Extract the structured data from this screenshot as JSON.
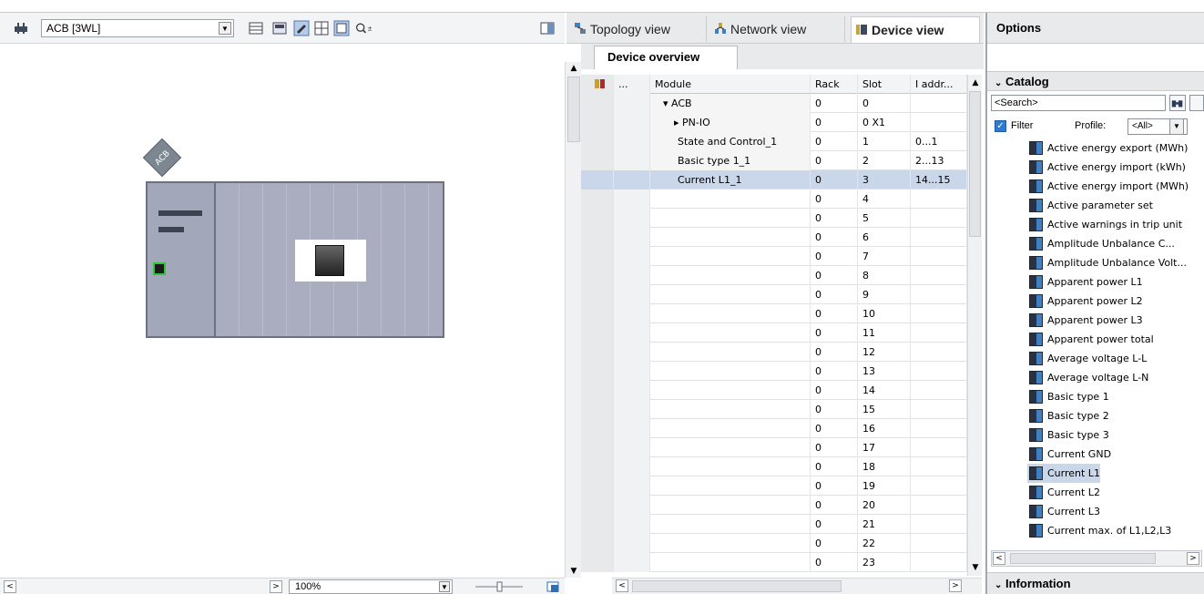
{
  "left": {
    "device_select": "ACB [3WL]",
    "zoom": "100%",
    "rack_label": "ACB"
  },
  "view_tabs": [
    {
      "label": "Topology view"
    },
    {
      "label": "Network view"
    },
    {
      "label": "Device view"
    }
  ],
  "overview": {
    "tab_label": "Device overview",
    "columns": [
      "...",
      "Module",
      "Rack",
      "Slot",
      "I addr..."
    ],
    "rows": [
      {
        "module": "▾ ACB",
        "rack": "0",
        "slot": "0",
        "iaddr": ""
      },
      {
        "module": "▸ PN-IO",
        "rack": "0",
        "slot": "0 X1",
        "iaddr": ""
      },
      {
        "module": "State and Control_1",
        "rack": "0",
        "slot": "1",
        "iaddr": "0...1"
      },
      {
        "module": "Basic type 1_1",
        "rack": "0",
        "slot": "2",
        "iaddr": "2...13"
      },
      {
        "module": "Current L1_1",
        "rack": "0",
        "slot": "3",
        "iaddr": "14...15"
      },
      {
        "module": "",
        "rack": "0",
        "slot": "4",
        "iaddr": ""
      },
      {
        "module": "",
        "rack": "0",
        "slot": "5",
        "iaddr": ""
      },
      {
        "module": "",
        "rack": "0",
        "slot": "6",
        "iaddr": ""
      },
      {
        "module": "",
        "rack": "0",
        "slot": "7",
        "iaddr": ""
      },
      {
        "module": "",
        "rack": "0",
        "slot": "8",
        "iaddr": ""
      },
      {
        "module": "",
        "rack": "0",
        "slot": "9",
        "iaddr": ""
      },
      {
        "module": "",
        "rack": "0",
        "slot": "10",
        "iaddr": ""
      },
      {
        "module": "",
        "rack": "0",
        "slot": "11",
        "iaddr": ""
      },
      {
        "module": "",
        "rack": "0",
        "slot": "12",
        "iaddr": ""
      },
      {
        "module": "",
        "rack": "0",
        "slot": "13",
        "iaddr": ""
      },
      {
        "module": "",
        "rack": "0",
        "slot": "14",
        "iaddr": ""
      },
      {
        "module": "",
        "rack": "0",
        "slot": "15",
        "iaddr": ""
      },
      {
        "module": "",
        "rack": "0",
        "slot": "16",
        "iaddr": ""
      },
      {
        "module": "",
        "rack": "0",
        "slot": "17",
        "iaddr": ""
      },
      {
        "module": "",
        "rack": "0",
        "slot": "18",
        "iaddr": ""
      },
      {
        "module": "",
        "rack": "0",
        "slot": "19",
        "iaddr": ""
      },
      {
        "module": "",
        "rack": "0",
        "slot": "20",
        "iaddr": ""
      },
      {
        "module": "",
        "rack": "0",
        "slot": "21",
        "iaddr": ""
      },
      {
        "module": "",
        "rack": "0",
        "slot": "22",
        "iaddr": ""
      },
      {
        "module": "",
        "rack": "0",
        "slot": "23",
        "iaddr": ""
      }
    ],
    "selected_row": 4
  },
  "options": {
    "title": "Options",
    "catalog_label": "Catalog",
    "search_placeholder": "<Search>",
    "filter_label": "Filter",
    "profile_label": "Profile:",
    "profile_value": "<All>",
    "items": [
      "Active energy export (MWh)",
      "Active energy import (kWh)",
      "Active energy import (MWh)",
      "Active parameter set",
      "Active warnings in trip unit",
      "Amplitude Unbalance C...",
      "Amplitude Unbalance Volt...",
      "Apparent power L1",
      "Apparent power L2",
      "Apparent power L3",
      "Apparent power total",
      "Average voltage L-L",
      "Average voltage L-N",
      "Basic type 1",
      "Basic type 2",
      "Basic type 3",
      "Current GND",
      "Current L1",
      "Current L2",
      "Current L3",
      "Current max. of L1,L2,L3"
    ],
    "selected_item": 17,
    "info_label": "Information"
  }
}
